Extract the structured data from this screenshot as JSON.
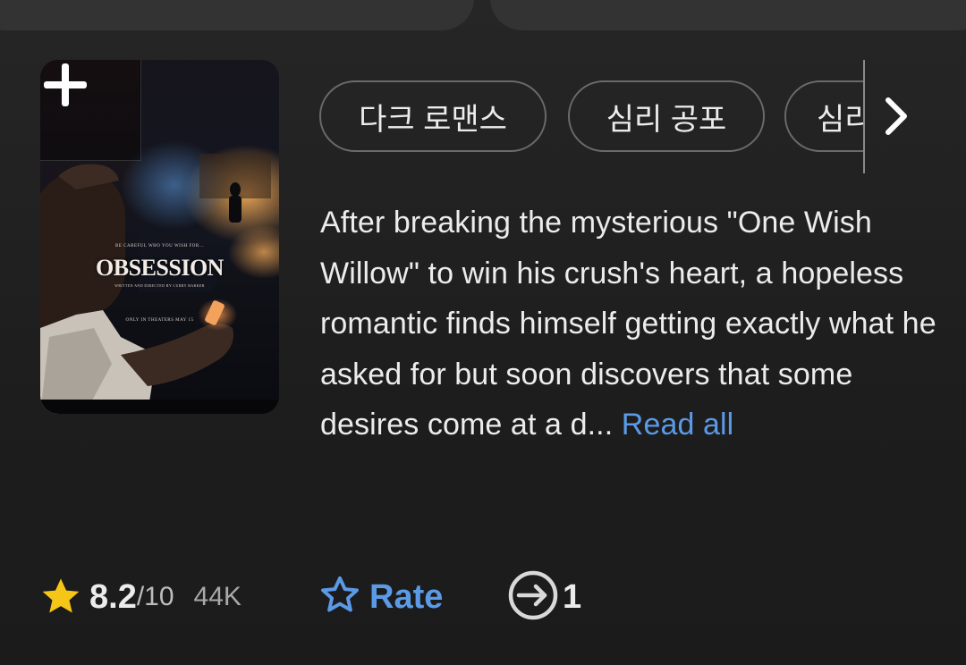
{
  "poster": {
    "add_icon": "plus-icon",
    "tagline": "BE CAREFUL WHO YOU WISH FOR...",
    "title": "OBSESSION",
    "credit": "WRITTEN AND DIRECTED BY CURRY BARKER",
    "release": "ONLY IN THEATERS MAY 15"
  },
  "genres": {
    "chips": [
      "다크 로맨스",
      "심리 공포",
      "심리"
    ],
    "next_icon": "chevron-right-icon"
  },
  "description": {
    "text": "After breaking the mysterious \"One Wish Willow\" to win his crush's heart, a hopeless romantic finds himself getting exactly what he asked for but soon discovers that some desires come at a d...",
    "read_all_label": "Read all"
  },
  "rating": {
    "star_icon": "star-filled-icon",
    "value": "8.2",
    "max": "/10",
    "votes": "44K"
  },
  "rate": {
    "icon": "star-outline-icon",
    "label": "Rate"
  },
  "share": {
    "icon": "arrow-circle-icon",
    "count": "1"
  },
  "colors": {
    "accent": "#5b9ae6",
    "star": "#f5c518",
    "background": "#1f1f1f"
  }
}
